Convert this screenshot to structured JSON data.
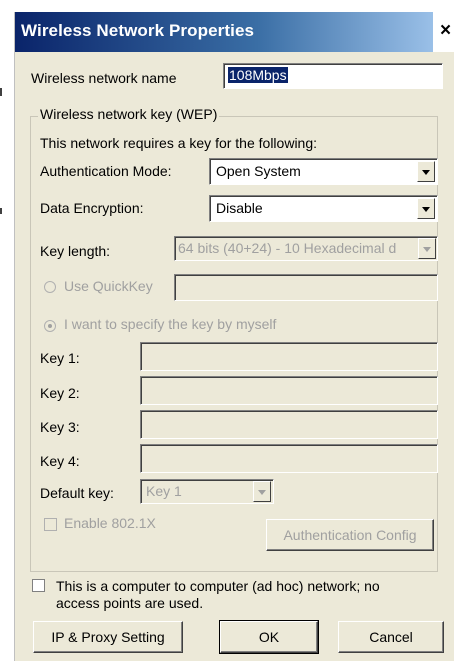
{
  "window": {
    "title": "Wireless Network Properties",
    "close_glyph": "×",
    "close_icon": "close-icon"
  },
  "network_name": {
    "label": "Wireless network name",
    "value": "108Mbps",
    "selected": true
  },
  "wep_group": {
    "title": "Wireless network key (WEP)",
    "requirement_text": "This network requires a key for the following:",
    "auth_mode": {
      "label": "Authentication Mode:",
      "value": "Open System"
    },
    "data_encryption": {
      "label": "Data Encryption:",
      "value": "Disable"
    },
    "key_length": {
      "label": "Key length:",
      "value": "64 bits (40+24) - 10 Hexadecimal d"
    },
    "use_quickkey": {
      "label": "Use QuickKey",
      "selected": false,
      "enabled": false
    },
    "specify_key": {
      "label": "I want to specify the key by myself",
      "selected": true,
      "enabled": false
    },
    "keys": [
      {
        "label": "Key 1:",
        "value": ""
      },
      {
        "label": "Key 2:",
        "value": ""
      },
      {
        "label": "Key 3:",
        "value": ""
      },
      {
        "label": "Key 4:",
        "value": ""
      }
    ],
    "default_key": {
      "label": "Default key:",
      "value": "Key 1"
    },
    "enable_8021x": {
      "label": "Enable 802.1X",
      "checked": false,
      "enabled": false
    },
    "auth_config_button": "Authentication Config"
  },
  "adhoc": {
    "line1": "This is a computer to computer (ad hoc) network; no",
    "line2": "access points are used.",
    "checked": false
  },
  "buttons": {
    "ip_proxy": "IP & Proxy Setting",
    "ok": "OK",
    "cancel": "Cancel"
  },
  "colors": {
    "title_bar": "#0a246a",
    "dialog_bg": "#ece9d8",
    "disabled_text": "#a0a0a0"
  }
}
